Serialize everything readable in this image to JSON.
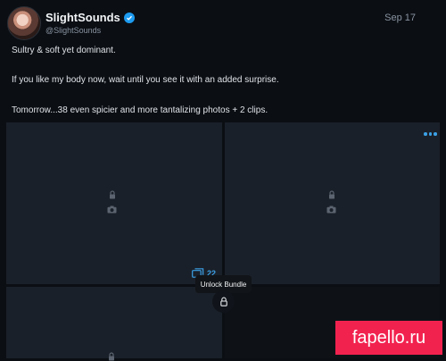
{
  "author": {
    "display_name": "SlightSounds",
    "handle": "@SlightSounds",
    "verified_icon": "verified-check-icon",
    "avatar_icon": "profile-photo"
  },
  "post": {
    "date": "Sep 17",
    "lines": [
      "Sultry & soft yet dominant.",
      "If you like my body now, wait until you see it with an added surprise.",
      "Tomorrow...38 even spicier and more tantalizing photos + 2 clips."
    ]
  },
  "media": {
    "tile_icons": [
      "lock-icon",
      "camera-icon"
    ],
    "more_icon": "more-horizontal-icon"
  },
  "bundle": {
    "count": "22",
    "count_icon": "media-stack-icon",
    "unlock_label": "Unlock Bundle",
    "lock_icon": "lock-icon"
  },
  "watermark": {
    "text": "fapello.ru"
  },
  "colors": {
    "background": "#0b0f14",
    "tile": "#1a2029",
    "accent": "#3ba0e6",
    "verified": "#1d9bf0",
    "watermark": "#f2224f"
  }
}
